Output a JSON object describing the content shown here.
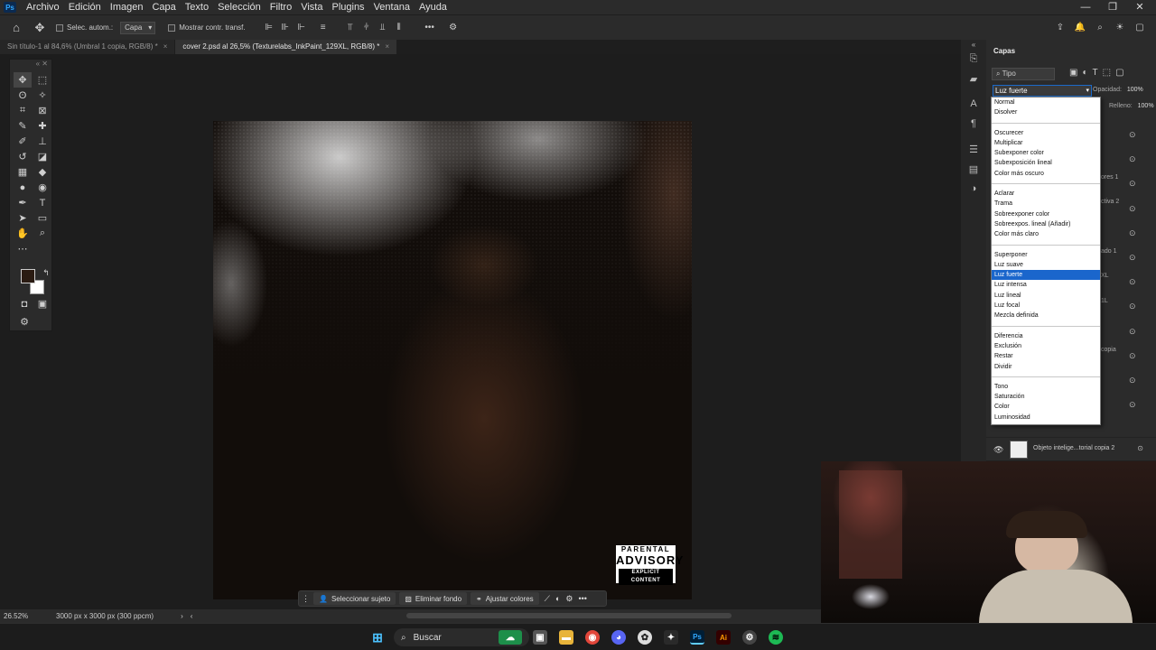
{
  "menubar": {
    "items": [
      "Archivo",
      "Edición",
      "Imagen",
      "Capa",
      "Texto",
      "Selección",
      "Filtro",
      "Vista",
      "Plugins",
      "Ventana",
      "Ayuda"
    ],
    "logo": "Ps"
  },
  "options": {
    "auto_select_label": "Selec. autom.:",
    "auto_select_value": "Capa",
    "show_transform_label": "Mostrar contr. transf."
  },
  "tabs": [
    {
      "label": "Sin título-1 al 84,6% (Umbral 1 copia, RGB/8) *",
      "active": false
    },
    {
      "label": "cover 2.psd al 26,5% (Texturelabs_InkPaint_129XL, RGB/8) *",
      "active": true
    }
  ],
  "canvas": {
    "advisory_top": "PARENTAL",
    "advisory_mid": "ADVISORY",
    "advisory_bottom": "EXPLICIT CONTENT"
  },
  "context_bar": {
    "select_subject": "Seleccionar sujeto",
    "remove_bg": "Eliminar fondo",
    "adjust_colors": "Ajustar colores"
  },
  "status": {
    "zoom": "26.52%",
    "doc_info": "3000 px x 3000 px (300 ppcm)"
  },
  "layers_panel": {
    "title": "Capas",
    "filter": "Tipo",
    "blend_mode": "Luz fuerte",
    "opacity_label": "Opacidad:",
    "opacity_value": "100%",
    "fill_label": "Relleno:",
    "fill_value": "100%",
    "bottom_layer": "Objeto intelige...torial copia 2",
    "partial_names": [
      "ores 1",
      "ctiva 2",
      "ado 1",
      "XL",
      "1L",
      "copia"
    ]
  },
  "blend_groups": [
    [
      "Normal",
      "Disolver"
    ],
    [
      "Oscurecer",
      "Multiplicar",
      "Subexponer color",
      "Subexposición lineal",
      "Color más oscuro"
    ],
    [
      "Aclarar",
      "Trama",
      "Sobreexponer color",
      "Sobreexpos. lineal (Añadir)",
      "Color más claro"
    ],
    [
      "Superponer",
      "Luz suave",
      "Luz fuerte",
      "Luz intensa",
      "Luz lineal",
      "Luz focal",
      "Mezcla definida"
    ],
    [
      "Diferencia",
      "Exclusión",
      "Restar",
      "Dividir"
    ],
    [
      "Tono",
      "Saturación",
      "Color",
      "Luminosidad"
    ]
  ],
  "blend_selected": "Luz fuerte",
  "taskbar": {
    "search_placeholder": "Buscar"
  },
  "colors": {
    "accent": "#1a66cc",
    "foreground_swatch": "#2a1b12",
    "background_swatch": "#ffffff"
  }
}
